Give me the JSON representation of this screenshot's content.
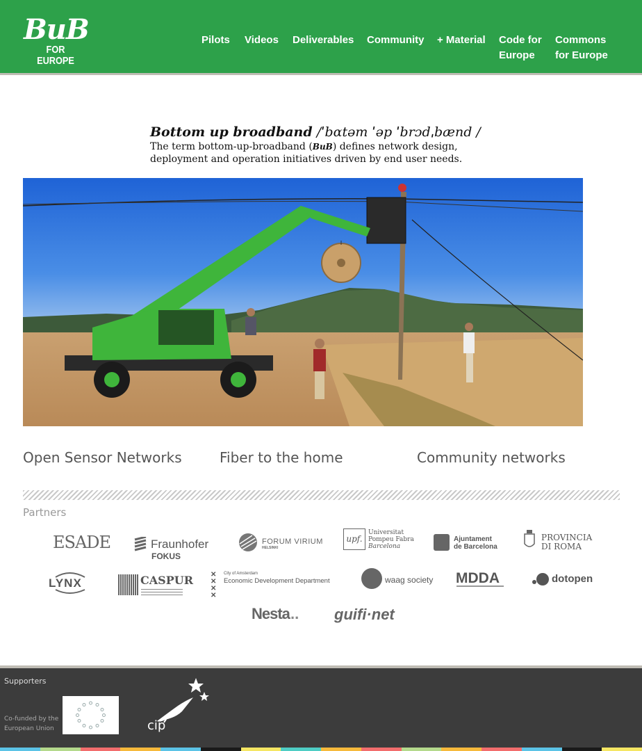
{
  "header": {
    "logo_main": "BuB",
    "logo_sub": "FOR EUROPE",
    "nav": [
      {
        "line1": "Pilots",
        "line2": ""
      },
      {
        "line1": "Videos",
        "line2": ""
      },
      {
        "line1": "Deliverables",
        "line2": ""
      },
      {
        "line1": "Community",
        "line2": ""
      },
      {
        "line1": "+ Material",
        "line2": ""
      },
      {
        "line1": "Code for",
        "line2": "Europe"
      },
      {
        "line1": "Commons",
        "line2": "for Europe"
      }
    ]
  },
  "intro": {
    "term": "Bottom up broadband",
    "phonetic": " /ˈbɑtəm ˈəp ˈbrɔdˌbænd /",
    "desc_line1_pre": "The term bottom-up-broadband (",
    "desc_abbr": "BuB",
    "desc_line1_post": ") defines network design,",
    "desc_line2": "deployment and operation initiatives driven by end user needs."
  },
  "features": [
    "Open Sensor Networks",
    "Fiber to the home",
    "Community networks"
  ],
  "partners": {
    "title": "Partners",
    "logos": [
      {
        "name": "ESADE",
        "icon": "esade-logo"
      },
      {
        "name": "Fraunhofer",
        "sub": "FOKUS",
        "icon": "fraunhofer-logo"
      },
      {
        "name": "FORUM VIRIUM",
        "sub": "HELSINKI",
        "icon": "forum-virium-logo"
      },
      {
        "name": "Universitat",
        "name2": "Pompeu Fabra",
        "sub": "Barcelona",
        "abbr": "upf.",
        "icon": "upf-logo"
      },
      {
        "name": "Ajuntament",
        "name2": "de Barcelona",
        "icon": "ajuntament-logo"
      },
      {
        "name": "PROVINCIA",
        "name2": "DI ROMA",
        "icon": "provincia-roma-logo"
      },
      {
        "name": "LYNX",
        "icon": "lynx-logo"
      },
      {
        "name": "CASPUR",
        "icon": "caspur-logo"
      },
      {
        "name": "City of Amsterdam",
        "name2": "Economic Development Department",
        "icon": "amsterdam-logo"
      },
      {
        "name": "waag society",
        "icon": "waag-logo"
      },
      {
        "name": "MDDA",
        "icon": "mdda-logo"
      },
      {
        "name": "dotopen",
        "icon": "dotopen-logo"
      },
      {
        "name": "Nesta",
        "icon": "nesta-logo"
      },
      {
        "name": "guifi·net",
        "icon": "guifi-logo"
      }
    ]
  },
  "footer": {
    "supporters": "Supporters",
    "cofunded_line1": "Co-funded by the",
    "cofunded_line2": "European Union",
    "cip": "cip"
  },
  "colors": {
    "brand_green": "#2da14a",
    "footer_bg": "#3c3c3c",
    "colorbar": [
      "#5bc3e6",
      "#b4d98c",
      "#f26d6d",
      "#f6b93b",
      "#5bc3e6",
      "#1a1a1a",
      "#f5e663",
      "#4ecdc4",
      "#f6b93b",
      "#f26d6d",
      "#b4d98c",
      "#f6b93b",
      "#f26d6d",
      "#5bc3e6",
      "#1a1a1a",
      "#f5e663"
    ]
  }
}
